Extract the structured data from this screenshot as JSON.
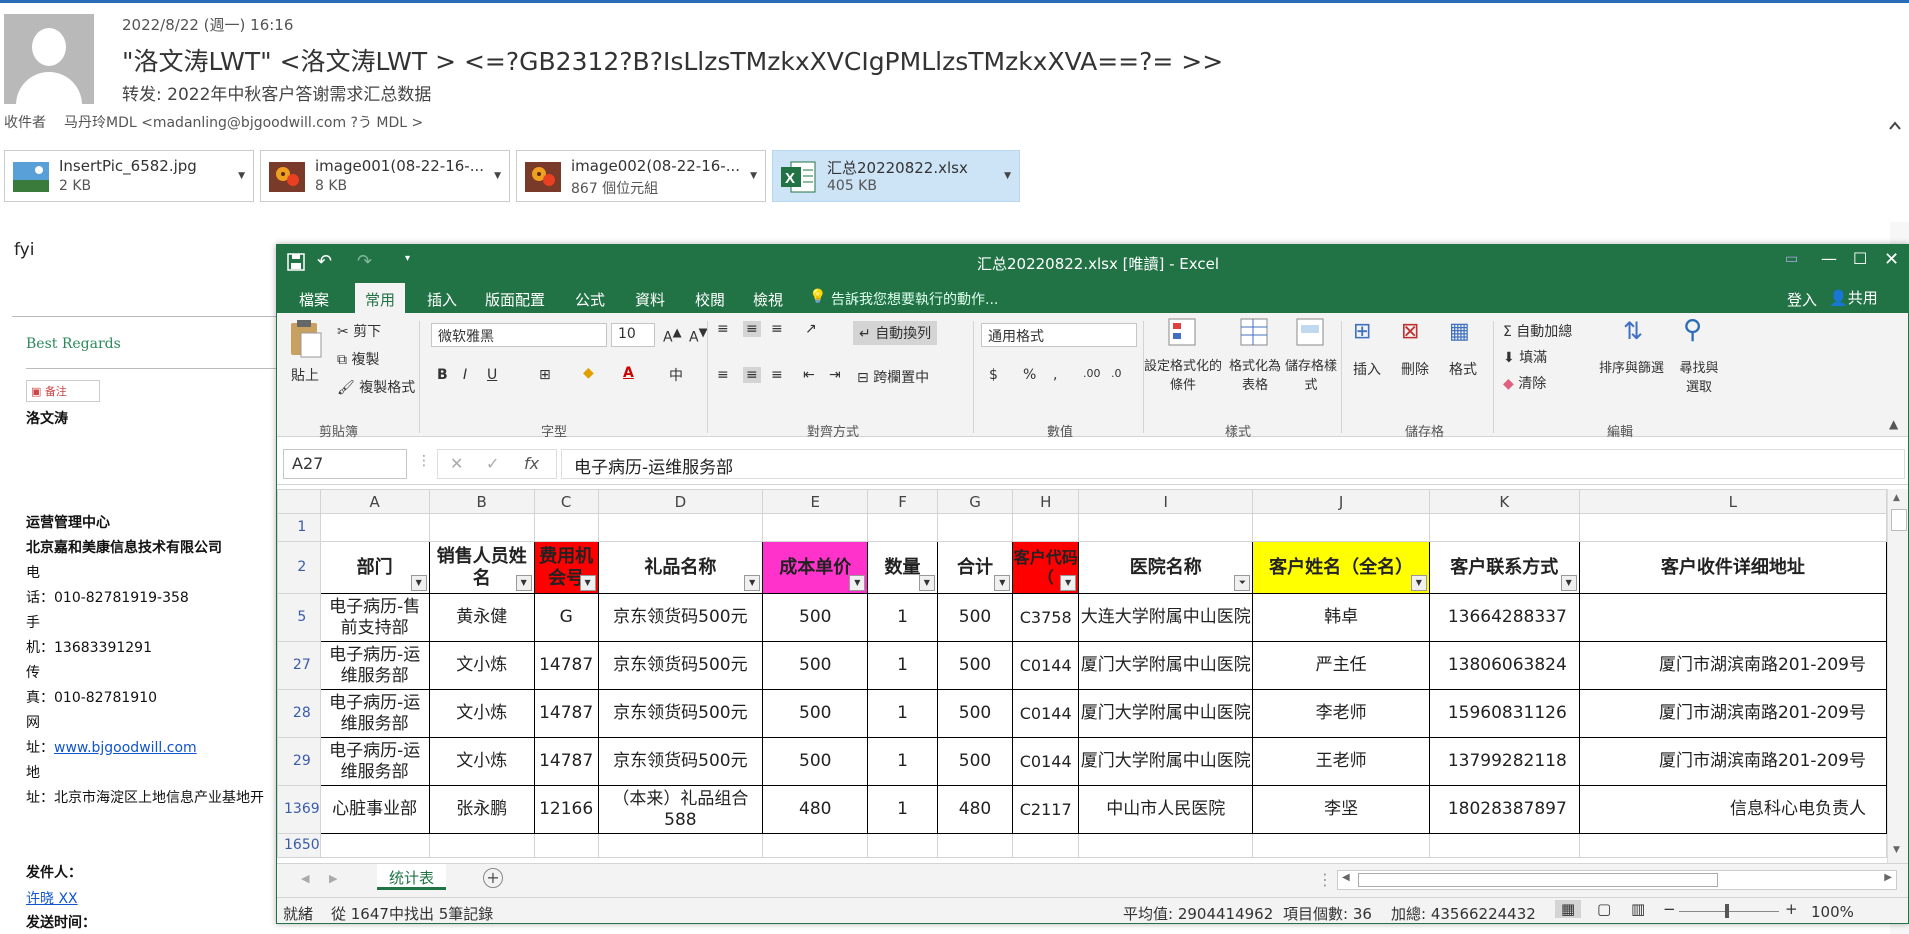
{
  "email": {
    "date": "2022/8/22 (週一) 16:16",
    "from": "\"洛文涛LWT\" <洛文涛LWT > <=?GB2312?B?IsLlzsTMzkxXVCIgPMLlzsTMzkxXVA==?= >>",
    "subject": "转发: 2022年中秋客户答谢需求汇总数据",
    "recipient_label": "收件者",
    "recipient": "马丹玲MDL <madanling@bjgoodwill.com ?う    MDL >"
  },
  "attachments": [
    {
      "name": "InsertPic_6582.jpg",
      "size": "2 KB",
      "icon": "image-thumb-icon"
    },
    {
      "name": "image001(08-22-16-...",
      "size": "8 KB",
      "icon": "flower-image-icon"
    },
    {
      "name": "image002(08-22-16-...",
      "size": "867 個位元組",
      "icon": "flower-image-icon"
    },
    {
      "name": "汇总20220822.xlsx",
      "size": "405 KB",
      "icon": "excel-file-icon"
    }
  ],
  "body": {
    "fyi": "fyi",
    "best_regards": "Best Regards",
    "sig_box": "▣ 备注",
    "sig_name": "洛文涛",
    "lines": [
      "运营管理中心",
      "北京嘉和美康信息技术有限公司",
      "电",
      "话：010-82781919-358",
      "手",
      "机：13683391291",
      "传",
      "真：010-82781910",
      "网",
      "址：",
      "地",
      "址：北京市海淀区上地信息产业基地开"
    ],
    "website": "www.bjgoodwill.com",
    "sender_label": "发件人：",
    "sender_name": "许晓 XX",
    "sent_label": "发送时间："
  },
  "excel": {
    "title": "汇总20220822.xlsx  [唯讀] - Excel",
    "tabs": [
      "檔案",
      "常用",
      "插入",
      "版面配置",
      "公式",
      "資料",
      "校閱",
      "檢視"
    ],
    "tell_me": "告訴我您想要執行的動作...",
    "login": "登入",
    "share": "共用",
    "ribbon": {
      "paste": "貼上",
      "cut": "剪下",
      "copy": "複製",
      "format_painter": "複製格式",
      "clipboard": "剪貼簿",
      "font_name": "微软雅黑",
      "font_size": "10",
      "font": "字型",
      "wrap": "自動換列",
      "merge": "跨欄置中",
      "alignment": "對齊方式",
      "number_format": "通用格式",
      "number": "數值",
      "cond_fmt": "設定格式化的條件",
      "fmt_table": "格式化為表格",
      "cell_styles": "儲存格樣式",
      "styles": "樣式",
      "insert": "插入",
      "delete": "刪除",
      "format": "格式",
      "cells": "儲存格",
      "autosum": "自動加總",
      "fill": "填滿",
      "clear": "清除",
      "sort_filter": "排序與篩選",
      "find_select": "尋找與選取",
      "editing": "編輯"
    },
    "name_box": "A27",
    "formula": "电子病历-运维服务部",
    "columns": [
      "A",
      "B",
      "C",
      "D",
      "E",
      "F",
      "G",
      "H",
      "I",
      "J",
      "K",
      "L"
    ],
    "headers": [
      "部门",
      "销售人员姓名",
      "费用机会号",
      "礼品名称",
      "成本单价",
      "数量",
      "合计",
      "客户代码（",
      "医院名称",
      "客户姓名（全名）",
      "客户联系方式",
      "客户收件详细地址"
    ],
    "rows": [
      {
        "num": "5",
        "cells": [
          "电子病历-售前支持部",
          "黄永健",
          "G",
          "京东领货码500元",
          "500",
          "1",
          "500",
          "C3758",
          "大连大学附属中山医院",
          "韩卓",
          "13664288337",
          ""
        ]
      },
      {
        "num": "27",
        "cells": [
          "电子病历-运维服务部",
          "文小炼",
          "14787",
          "京东领货码500元",
          "500",
          "1",
          "500",
          "C0144",
          "厦门大学附属中山医院",
          "严主任",
          "13806063824",
          "厦门市湖滨南路201-209号"
        ]
      },
      {
        "num": "28",
        "cells": [
          "电子病历-运维服务部",
          "文小炼",
          "14787",
          "京东领货码500元",
          "500",
          "1",
          "500",
          "C0144",
          "厦门大学附属中山医院",
          "李老师",
          "15960831126",
          "厦门市湖滨南路201-209号"
        ]
      },
      {
        "num": "29",
        "cells": [
          "电子病历-运维服务部",
          "文小炼",
          "14787",
          "京东领货码500元",
          "500",
          "1",
          "500",
          "C0144",
          "厦门大学附属中山医院",
          "王老师",
          "13799282118",
          "厦门市湖滨南路201-209号"
        ]
      },
      {
        "num": "1369",
        "cells": [
          "心脏事业部",
          "张永鹏",
          "12166",
          "（本来）礼品组合588",
          "480",
          "1",
          "480",
          "C2117",
          "中山市人民医院",
          "李坚",
          "18028387897",
          "信息科心电负责人"
        ]
      }
    ],
    "last_row": "1650",
    "sheet_tab": "统计表",
    "status_left": "就緒",
    "status_found": "從 1647中找出 5筆記錄",
    "average": "平均值: 2904414962",
    "count": "項目個數: 36",
    "sum": "加總: 43566224432",
    "zoom": "100%",
    "colors": {
      "green": "#217346",
      "red": "#ff0000",
      "magenta": "#ff33cc",
      "yellow": "#ffff00"
    }
  }
}
